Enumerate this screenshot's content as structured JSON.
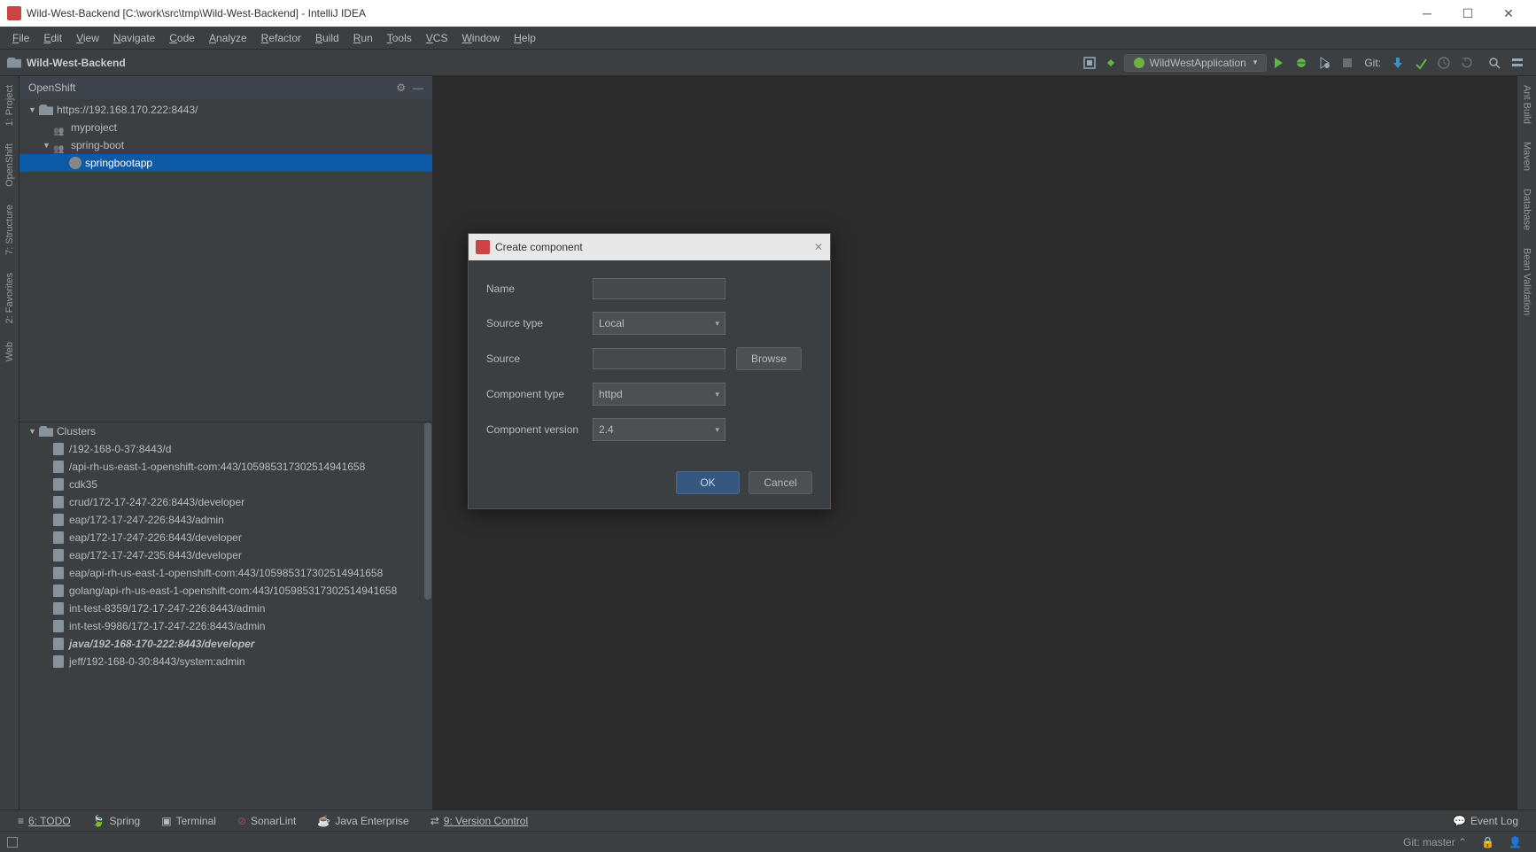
{
  "title": "Wild-West-Backend [C:\\work\\src\\tmp\\Wild-West-Backend] - IntelliJ IDEA",
  "breadcrumb": "Wild-West-Backend",
  "menu": [
    "File",
    "Edit",
    "View",
    "Navigate",
    "Code",
    "Analyze",
    "Refactor",
    "Build",
    "Run",
    "Tools",
    "VCS",
    "Window",
    "Help"
  ],
  "run_config": "WildWestApplication",
  "git_label": "Git:",
  "panel": {
    "title": "OpenShift"
  },
  "left_tabs": [
    "1: Project",
    "OpenShift",
    "7: Structure",
    "2: Favorites",
    "Web"
  ],
  "right_tabs": [
    "Ant Build",
    "Maven",
    "Database",
    "Bean Validation"
  ],
  "tree": {
    "root": "https://192.168.170.222:8443/",
    "myproject": "myproject",
    "springboot": "spring-boot",
    "app": "springbootapp"
  },
  "clusters_header": "Clusters",
  "clusters": [
    "/192-168-0-37:8443/d",
    "/api-rh-us-east-1-openshift-com:443/105985317302514941658",
    "cdk35",
    "crud/172-17-247-226:8443/developer",
    "eap/172-17-247-226:8443/admin",
    "eap/172-17-247-226:8443/developer",
    "eap/172-17-247-235:8443/developer",
    "eap/api-rh-us-east-1-openshift-com:443/105985317302514941658",
    "golang/api-rh-us-east-1-openshift-com:443/105985317302514941658",
    "int-test-8359/172-17-247-226:8443/admin",
    "int-test-9986/172-17-247-226:8443/admin",
    "java/192-168-170-222:8443/developer",
    "jeff/192-168-0-30:8443/system:admin"
  ],
  "clusters_bold_index": 11,
  "bottom": {
    "todo": "6: TODO",
    "spring": "Spring",
    "terminal": "Terminal",
    "sonar": "SonarLint",
    "je": "Java Enterprise",
    "vc": "9: Version Control",
    "eventlog": "Event Log"
  },
  "status": {
    "git": "Git: master"
  },
  "dialog": {
    "title": "Create component",
    "name_label": "Name",
    "source_type_label": "Source type",
    "source_type_value": "Local",
    "source_label": "Source",
    "browse": "Browse",
    "comp_type_label": "Component type",
    "comp_type_value": "httpd",
    "comp_ver_label": "Component version",
    "comp_ver_value": "2.4",
    "ok": "OK",
    "cancel": "Cancel"
  }
}
